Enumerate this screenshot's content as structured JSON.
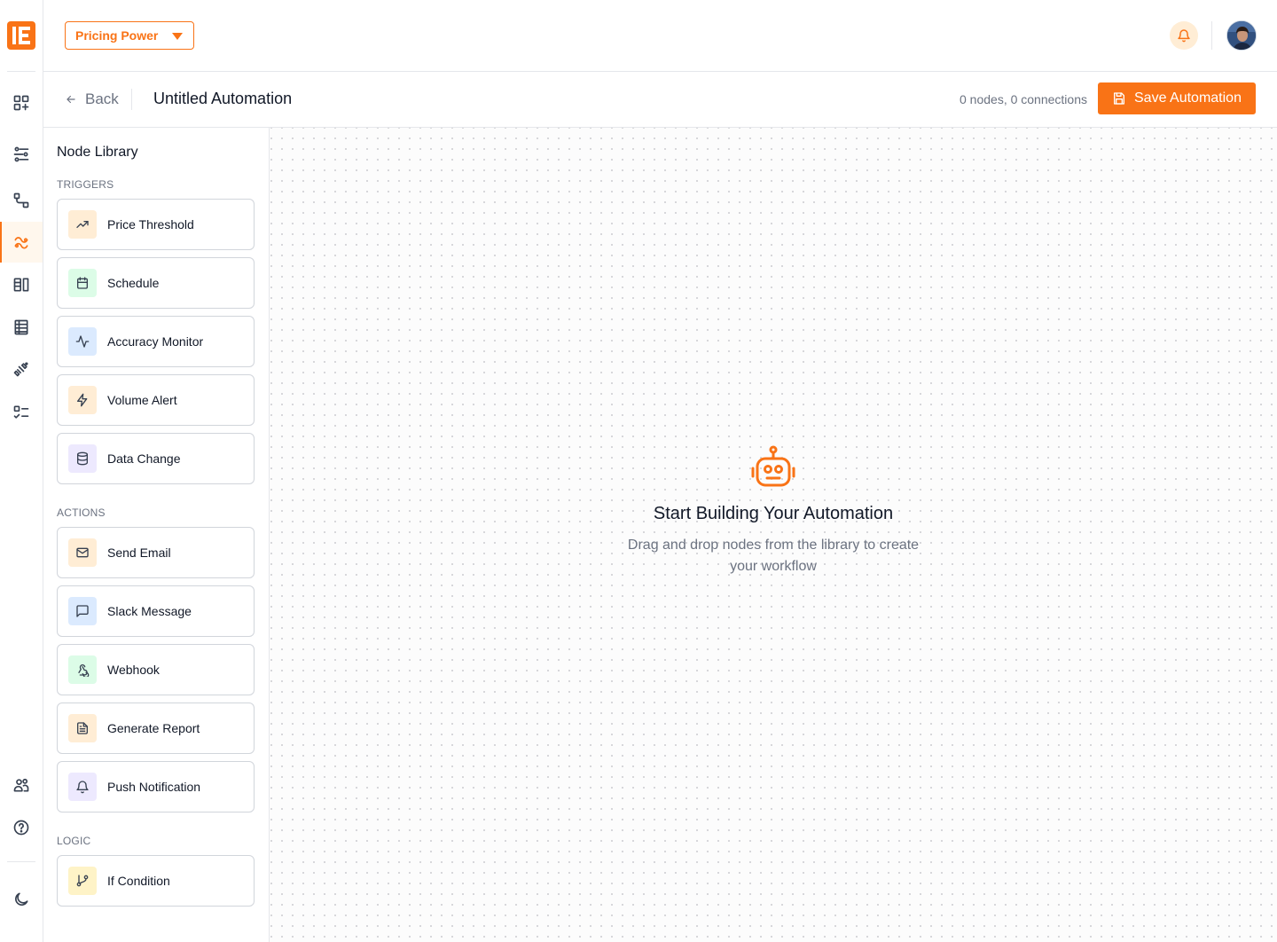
{
  "topbar": {
    "workspace": "Pricing Power",
    "notifications_icon": "bell-icon",
    "avatar_icon": "user-avatar"
  },
  "rail": {
    "items": [
      {
        "icon": "grid-plus-icon"
      },
      {
        "icon": "sliders-icon"
      },
      {
        "icon": "flow-icon"
      },
      {
        "icon": "automation-icon",
        "active": true
      },
      {
        "icon": "columns-icon"
      },
      {
        "icon": "table-icon"
      },
      {
        "icon": "satellite-icon"
      },
      {
        "icon": "checklist-icon"
      },
      {
        "icon": "users-icon"
      },
      {
        "icon": "help-icon"
      },
      {
        "icon": "moon-icon"
      }
    ]
  },
  "subheader": {
    "back_label": "Back",
    "title": "Untitled Automation",
    "counts": "0 nodes, 0 connections",
    "save_label": "Save Automation"
  },
  "library": {
    "title": "Node Library",
    "triggers_label": "TRIGGERS",
    "triggers": [
      {
        "label": "Price Threshold",
        "icon": "trending-up-icon",
        "tint": "#ffedd5"
      },
      {
        "label": "Schedule",
        "icon": "calendar-icon",
        "tint": "#dcfce7"
      },
      {
        "label": "Accuracy Monitor",
        "icon": "activity-icon",
        "tint": "#dbeafe"
      },
      {
        "label": "Volume Alert",
        "icon": "zap-icon",
        "tint": "#ffedd5"
      },
      {
        "label": "Data Change",
        "icon": "database-icon",
        "tint": "#ede9fe"
      }
    ],
    "actions_label": "ACTIONS",
    "actions": [
      {
        "label": "Send Email",
        "icon": "mail-icon",
        "tint": "#ffedd5"
      },
      {
        "label": "Slack Message",
        "icon": "message-square-icon",
        "tint": "#dbeafe"
      },
      {
        "label": "Webhook",
        "icon": "webhook-icon",
        "tint": "#dcfce7"
      },
      {
        "label": "Generate Report",
        "icon": "file-text-icon",
        "tint": "#ffedd5"
      },
      {
        "label": "Push Notification",
        "icon": "bell-icon",
        "tint": "#ede9fe"
      }
    ],
    "logic_label": "LOGIC",
    "logic": [
      {
        "label": "If Condition",
        "icon": "git-branch-icon",
        "tint": "#fef3c7"
      }
    ]
  },
  "canvas": {
    "empty_icon": "robot-icon",
    "empty_title": "Start Building Your Automation",
    "empty_desc": "Drag and drop nodes from the library to create your workflow"
  },
  "colors": {
    "accent": "#f97316",
    "border": "#e5e7eb",
    "muted_text": "#6b7280"
  }
}
